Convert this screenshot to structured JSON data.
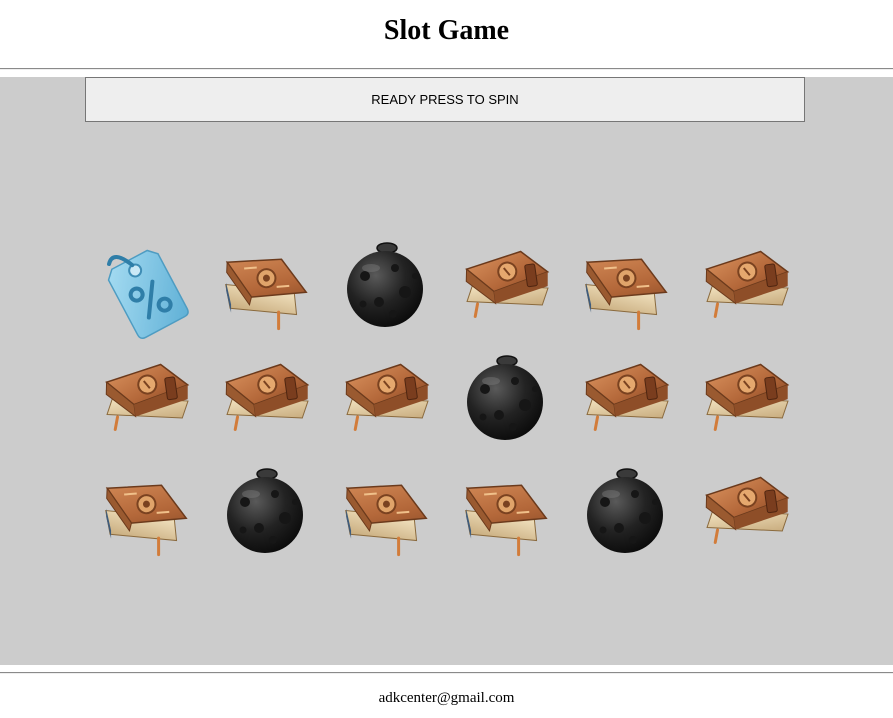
{
  "header": {
    "title": "Slot Game"
  },
  "status": {
    "message": "READY PRESS TO SPIN"
  },
  "reels": {
    "symbols": {
      "tag": {
        "icon": "discount-tag-icon",
        "color": "#7cc3e3"
      },
      "gear-book": {
        "icon": "gear-book-icon",
        "color": "#b87a45"
      },
      "clasp-book": {
        "icon": "clasp-book-icon",
        "color": "#b9744a"
      },
      "bomb": {
        "icon": "bomb-icon",
        "color": "#2a2a2a"
      }
    },
    "rows": [
      [
        "tag",
        "gear-book",
        "bomb",
        "clasp-book",
        "gear-book",
        "clasp-book"
      ],
      [
        "clasp-book",
        "clasp-book",
        "clasp-book",
        "bomb",
        "clasp-book",
        "clasp-book"
      ],
      [
        "gear-book",
        "bomb",
        "gear-book",
        "gear-book",
        "bomb",
        "clasp-book"
      ]
    ]
  },
  "footer": {
    "email": "adkcenter@gmail.com"
  }
}
